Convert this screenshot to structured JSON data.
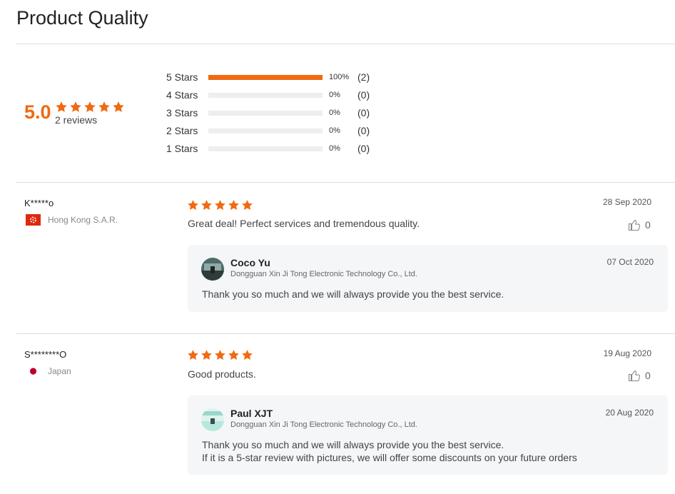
{
  "header": {
    "title": "Product Quality"
  },
  "summary": {
    "score": "5.0",
    "rating": 5,
    "reviews_label": "2 reviews"
  },
  "distribution": [
    {
      "label": "5  Stars",
      "percent_value": 100,
      "percent": "100%",
      "count": "(2)"
    },
    {
      "label": "4  Stars",
      "percent_value": 0,
      "percent": "0%",
      "count": "(0)"
    },
    {
      "label": "3  Stars",
      "percent_value": 0,
      "percent": "0%",
      "count": "(0)"
    },
    {
      "label": "2  Stars",
      "percent_value": 0,
      "percent": "0%",
      "count": "(0)"
    },
    {
      "label": "1  Stars",
      "percent_value": 0,
      "percent": "0%",
      "count": "(0)"
    }
  ],
  "reviews": [
    {
      "name": "K*****o",
      "country": "Hong Kong S.A.R.",
      "flag_icon": "hong-kong-flag-icon",
      "rating": 5,
      "date": "28 Sep 2020",
      "text": "Great deal! Perfect services and tremendous quality.",
      "likes": "0",
      "reply": {
        "name": "Coco Yu",
        "company": "Dongguan Xin Ji Tong Electronic Technology Co., Ltd.",
        "date": "07 Oct 2020",
        "text_line1": "Thank you so much and we will always provide you the best service.",
        "text_line2": ""
      }
    },
    {
      "name": "S********O",
      "country": "Japan",
      "flag_icon": "japan-flag-icon",
      "rating": 5,
      "date": "19 Aug 2020",
      "text": "Good products.",
      "likes": "0",
      "reply": {
        "name": "Paul XJT",
        "company": "Dongguan Xin Ji Tong Electronic Technology Co., Ltd.",
        "date": "20 Aug 2020",
        "text_line1": "Thank you so much and we will always provide you the best service.",
        "text_line2": "If it is a 5-star review with pictures, we will offer some discounts on your future orders"
      }
    }
  ],
  "colors": {
    "accent": "#ef6a12",
    "bar_empty": "#eeeeee",
    "reply_bg": "#f5f6f7",
    "divider": "#dcdcdc"
  },
  "icons": {
    "star": "star-icon",
    "like": "thumbs-up-icon"
  }
}
